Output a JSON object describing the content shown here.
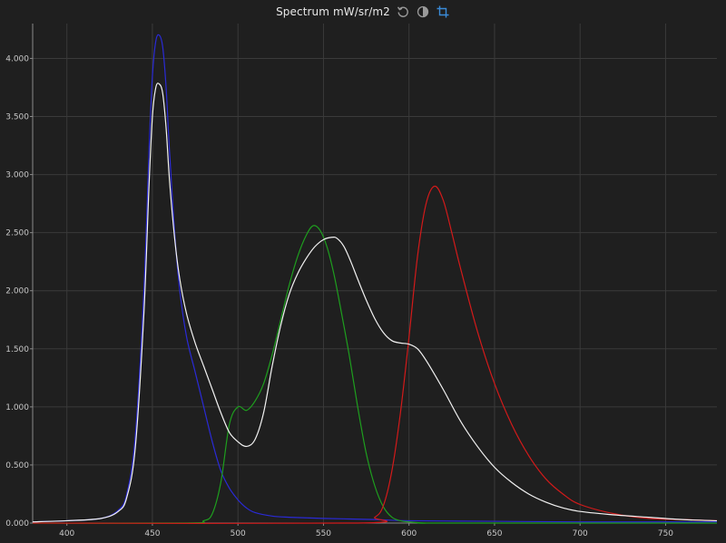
{
  "header": {
    "title": "Spectrum mW/sr/m2",
    "tools": [
      {
        "name": "reset-icon",
        "color": "#9a9a9a"
      },
      {
        "name": "contrast-icon",
        "color": "#9a9a9a"
      },
      {
        "name": "crop-icon",
        "color": "#3a8bd8"
      }
    ]
  },
  "chart_data": {
    "type": "line",
    "title": "Spectrum mW/sr/m2",
    "xlabel": "",
    "ylabel": "",
    "xlim": [
      380,
      780
    ],
    "ylim": [
      0,
      4.3
    ],
    "x_ticks": [
      400,
      450,
      500,
      550,
      600,
      650,
      700,
      750
    ],
    "x_tick_labels": [
      "400",
      "450",
      "500",
      "550",
      "600",
      "650",
      "700",
      "750"
    ],
    "y_ticks": [
      0,
      0.5,
      1,
      1.5,
      2,
      2.5,
      3,
      3.5,
      4
    ],
    "y_tick_labels": [
      "0.000",
      "0.500",
      "1.000",
      "1.500",
      "2.000",
      "2.500",
      "3.000",
      "3.500",
      "4.000"
    ],
    "grid": true,
    "colors": {
      "background": "#1f1f1f",
      "grid": "#3a3a3a",
      "axis": "#8a8a8a"
    },
    "series": [
      {
        "color": "#2a2ad6",
        "x": [
          380,
          400,
          420,
          430,
          435,
          440,
          445,
          448,
          450,
          452,
          454,
          456,
          458,
          460,
          463,
          466,
          470,
          475,
          480,
          485,
          490,
          495,
          500,
          505,
          510,
          520,
          530,
          550,
          580,
          600,
          650,
          700,
          780
        ],
        "y": [
          0.01,
          0.02,
          0.04,
          0.11,
          0.25,
          0.75,
          2.0,
          3.2,
          3.85,
          4.15,
          4.2,
          4.1,
          3.75,
          3.2,
          2.5,
          2.0,
          1.6,
          1.3,
          1.0,
          0.7,
          0.45,
          0.3,
          0.2,
          0.13,
          0.09,
          0.06,
          0.05,
          0.04,
          0.03,
          0.02,
          0.015,
          0.01,
          0.01
        ]
      },
      {
        "color": "#1e9e1e",
        "x": [
          380,
          470,
          480,
          485,
          490,
          495,
          500,
          505,
          510,
          515,
          520,
          525,
          530,
          535,
          540,
          544,
          548,
          552,
          556,
          560,
          565,
          570,
          575,
          580,
          585,
          590,
          595,
          600,
          610,
          620,
          780
        ],
        "y": [
          0,
          0,
          0.02,
          0.08,
          0.35,
          0.85,
          1.0,
          0.97,
          1.05,
          1.2,
          1.45,
          1.75,
          2.05,
          2.3,
          2.48,
          2.56,
          2.52,
          2.38,
          2.15,
          1.85,
          1.45,
          1.0,
          0.6,
          0.32,
          0.14,
          0.05,
          0.02,
          0.01,
          0,
          0,
          0
        ]
      },
      {
        "color": "#d21a1a",
        "x": [
          380,
          570,
          580,
          585,
          590,
          595,
          600,
          605,
          610,
          615,
          620,
          625,
          630,
          640,
          650,
          660,
          670,
          680,
          690,
          700,
          720,
          740,
          760,
          780
        ],
        "y": [
          0,
          0,
          0.05,
          0.15,
          0.45,
          0.95,
          1.6,
          2.3,
          2.75,
          2.9,
          2.78,
          2.5,
          2.2,
          1.65,
          1.2,
          0.85,
          0.58,
          0.38,
          0.25,
          0.16,
          0.08,
          0.04,
          0.03,
          0.02
        ]
      },
      {
        "color": "#f2f2f2",
        "x": [
          380,
          400,
          420,
          430,
          435,
          440,
          445,
          448,
          450,
          452,
          454,
          456,
          458,
          460,
          463,
          466,
          470,
          475,
          480,
          485,
          490,
          495,
          500,
          505,
          510,
          515,
          520,
          525,
          530,
          535,
          540,
          545,
          550,
          555,
          558,
          562,
          566,
          570,
          575,
          580,
          585,
          590,
          595,
          600,
          605,
          610,
          620,
          630,
          640,
          650,
          660,
          670,
          680,
          690,
          700,
          720,
          740,
          760,
          780
        ],
        "y": [
          0.01,
          0.02,
          0.04,
          0.1,
          0.22,
          0.65,
          1.8,
          2.9,
          3.5,
          3.75,
          3.78,
          3.7,
          3.4,
          2.95,
          2.45,
          2.1,
          1.8,
          1.55,
          1.35,
          1.15,
          0.95,
          0.78,
          0.7,
          0.66,
          0.72,
          0.95,
          1.35,
          1.7,
          1.97,
          2.15,
          2.28,
          2.38,
          2.44,
          2.46,
          2.45,
          2.38,
          2.25,
          2.1,
          1.92,
          1.76,
          1.64,
          1.57,
          1.55,
          1.54,
          1.5,
          1.4,
          1.15,
          0.88,
          0.66,
          0.48,
          0.35,
          0.25,
          0.18,
          0.13,
          0.1,
          0.07,
          0.05,
          0.03,
          0.02
        ]
      }
    ]
  }
}
